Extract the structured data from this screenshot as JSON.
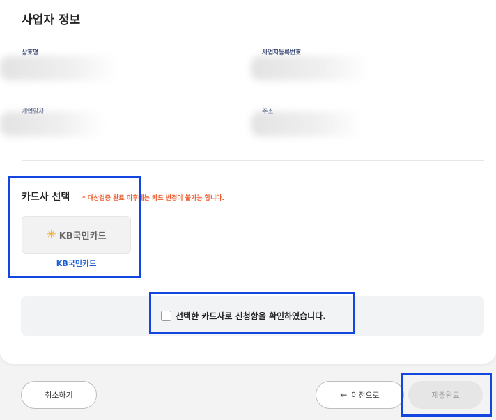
{
  "business_info": {
    "title": "사업자 정보",
    "fields": [
      {
        "label": "상호명"
      },
      {
        "label": "사업자등록번호"
      },
      {
        "label": "개업일자"
      },
      {
        "label": "주소"
      }
    ]
  },
  "card_select": {
    "title": "카드사 선택",
    "note": "* 대상검증 완료 이후에는 카드 변경이 불가능 합니다.",
    "cards": [
      {
        "logo_icon": "kb-star-icon",
        "logo_text": "KB국민카드",
        "name": "KB국민카드"
      }
    ]
  },
  "confirm": {
    "checked": false,
    "label": "선택한 카드사로 신청함을 확인하였습니다."
  },
  "footer": {
    "cancel_label": "취소하기",
    "prev_label": "이전으로",
    "prev_icon": "arrow-left-icon",
    "submit_label": "제출완료"
  },
  "colors": {
    "accent": "#1346e0",
    "note": "#ef5b2c",
    "card_name": "#1a5fd6"
  }
}
